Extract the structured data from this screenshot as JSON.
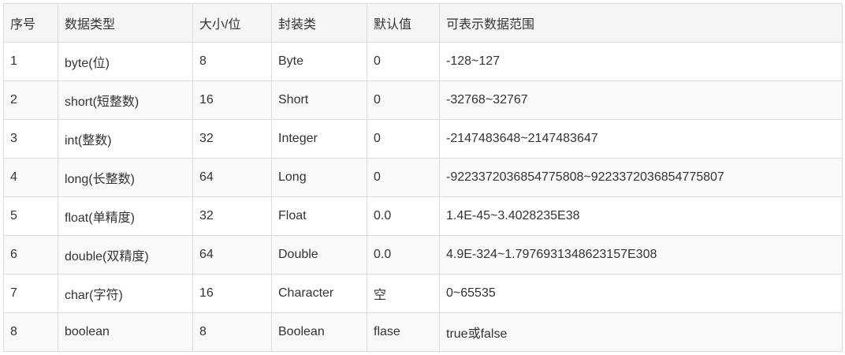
{
  "table": {
    "headers": [
      "序号",
      "数据类型",
      "大小/位",
      "封装类",
      "默认值",
      "可表示数据范围"
    ],
    "rows": [
      [
        "1",
        "byte(位)",
        "8",
        "Byte",
        "0",
        "-128~127"
      ],
      [
        "2",
        "short(短整数)",
        "16",
        "Short",
        "0",
        "-32768~32767"
      ],
      [
        "3",
        "int(整数)",
        "32",
        "Integer",
        "0",
        "-2147483648~2147483647"
      ],
      [
        "4",
        "long(长整数)",
        "64",
        "Long",
        "0",
        "-9223372036854775808~9223372036854775807"
      ],
      [
        "5",
        "float(单精度)",
        "32",
        "Float",
        "0.0",
        "1.4E-45~3.4028235E38"
      ],
      [
        "6",
        "double(双精度)",
        "64",
        "Double",
        "0.0",
        "4.9E-324~1.7976931348623157E308"
      ],
      [
        "7",
        "char(字符)",
        "16",
        "Character",
        "空",
        "0~65535"
      ],
      [
        "8",
        "boolean",
        "8",
        "Boolean",
        "flase",
        "true或false"
      ]
    ]
  }
}
